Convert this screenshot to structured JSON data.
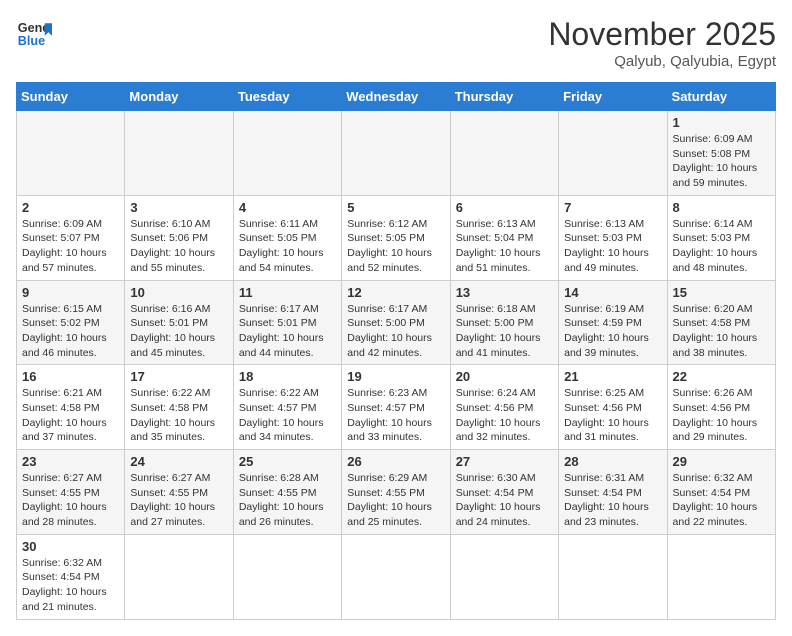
{
  "header": {
    "logo_general": "General",
    "logo_blue": "Blue",
    "month_title": "November 2025",
    "location": "Qalyub, Qalyubia, Egypt"
  },
  "weekdays": [
    "Sunday",
    "Monday",
    "Tuesday",
    "Wednesday",
    "Thursday",
    "Friday",
    "Saturday"
  ],
  "days": {
    "1": {
      "sunrise": "6:09 AM",
      "sunset": "5:08 PM",
      "daylight": "10 hours and 59 minutes."
    },
    "2": {
      "sunrise": "6:09 AM",
      "sunset": "5:07 PM",
      "daylight": "10 hours and 57 minutes."
    },
    "3": {
      "sunrise": "6:10 AM",
      "sunset": "5:06 PM",
      "daylight": "10 hours and 55 minutes."
    },
    "4": {
      "sunrise": "6:11 AM",
      "sunset": "5:05 PM",
      "daylight": "10 hours and 54 minutes."
    },
    "5": {
      "sunrise": "6:12 AM",
      "sunset": "5:05 PM",
      "daylight": "10 hours and 52 minutes."
    },
    "6": {
      "sunrise": "6:13 AM",
      "sunset": "5:04 PM",
      "daylight": "10 hours and 51 minutes."
    },
    "7": {
      "sunrise": "6:13 AM",
      "sunset": "5:03 PM",
      "daylight": "10 hours and 49 minutes."
    },
    "8": {
      "sunrise": "6:14 AM",
      "sunset": "5:03 PM",
      "daylight": "10 hours and 48 minutes."
    },
    "9": {
      "sunrise": "6:15 AM",
      "sunset": "5:02 PM",
      "daylight": "10 hours and 46 minutes."
    },
    "10": {
      "sunrise": "6:16 AM",
      "sunset": "5:01 PM",
      "daylight": "10 hours and 45 minutes."
    },
    "11": {
      "sunrise": "6:17 AM",
      "sunset": "5:01 PM",
      "daylight": "10 hours and 44 minutes."
    },
    "12": {
      "sunrise": "6:17 AM",
      "sunset": "5:00 PM",
      "daylight": "10 hours and 42 minutes."
    },
    "13": {
      "sunrise": "6:18 AM",
      "sunset": "5:00 PM",
      "daylight": "10 hours and 41 minutes."
    },
    "14": {
      "sunrise": "6:19 AM",
      "sunset": "4:59 PM",
      "daylight": "10 hours and 39 minutes."
    },
    "15": {
      "sunrise": "6:20 AM",
      "sunset": "4:58 PM",
      "daylight": "10 hours and 38 minutes."
    },
    "16": {
      "sunrise": "6:21 AM",
      "sunset": "4:58 PM",
      "daylight": "10 hours and 37 minutes."
    },
    "17": {
      "sunrise": "6:22 AM",
      "sunset": "4:58 PM",
      "daylight": "10 hours and 35 minutes."
    },
    "18": {
      "sunrise": "6:22 AM",
      "sunset": "4:57 PM",
      "daylight": "10 hours and 34 minutes."
    },
    "19": {
      "sunrise": "6:23 AM",
      "sunset": "4:57 PM",
      "daylight": "10 hours and 33 minutes."
    },
    "20": {
      "sunrise": "6:24 AM",
      "sunset": "4:56 PM",
      "daylight": "10 hours and 32 minutes."
    },
    "21": {
      "sunrise": "6:25 AM",
      "sunset": "4:56 PM",
      "daylight": "10 hours and 31 minutes."
    },
    "22": {
      "sunrise": "6:26 AM",
      "sunset": "4:56 PM",
      "daylight": "10 hours and 29 minutes."
    },
    "23": {
      "sunrise": "6:27 AM",
      "sunset": "4:55 PM",
      "daylight": "10 hours and 28 minutes."
    },
    "24": {
      "sunrise": "6:27 AM",
      "sunset": "4:55 PM",
      "daylight": "10 hours and 27 minutes."
    },
    "25": {
      "sunrise": "6:28 AM",
      "sunset": "4:55 PM",
      "daylight": "10 hours and 26 minutes."
    },
    "26": {
      "sunrise": "6:29 AM",
      "sunset": "4:55 PM",
      "daylight": "10 hours and 25 minutes."
    },
    "27": {
      "sunrise": "6:30 AM",
      "sunset": "4:54 PM",
      "daylight": "10 hours and 24 minutes."
    },
    "28": {
      "sunrise": "6:31 AM",
      "sunset": "4:54 PM",
      "daylight": "10 hours and 23 minutes."
    },
    "29": {
      "sunrise": "6:32 AM",
      "sunset": "4:54 PM",
      "daylight": "10 hours and 22 minutes."
    },
    "30": {
      "sunrise": "6:32 AM",
      "sunset": "4:54 PM",
      "daylight": "10 hours and 21 minutes."
    }
  }
}
